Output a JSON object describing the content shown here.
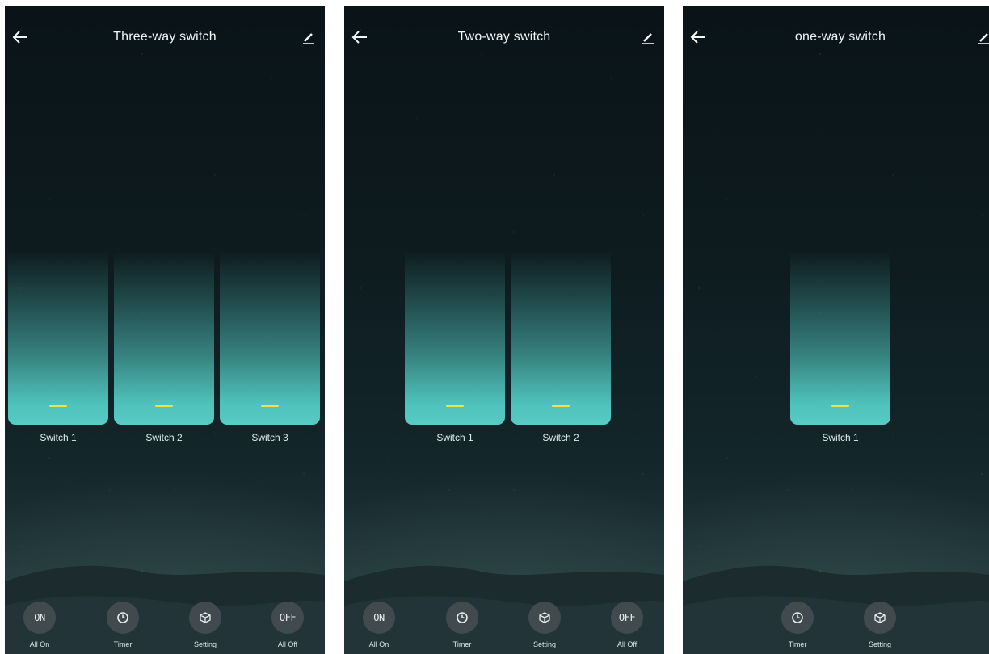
{
  "screens": [
    {
      "title": "Three-way switch",
      "switches": [
        "Switch 1",
        "Switch 2",
        "Switch 3"
      ],
      "actions": [
        {
          "label": "All On",
          "glyph": "ON",
          "icon": "power-on-icon"
        },
        {
          "label": "Timer",
          "icon": "clock-icon"
        },
        {
          "label": "Setting",
          "icon": "settings-cube-icon"
        },
        {
          "label": "All Off",
          "glyph": "OFF",
          "icon": "power-off-icon"
        }
      ]
    },
    {
      "title": "Two-way switch",
      "switches": [
        "Switch 1",
        "Switch 2"
      ],
      "actions": [
        {
          "label": "All On",
          "glyph": "ON",
          "icon": "power-on-icon"
        },
        {
          "label": "Timer",
          "icon": "clock-icon"
        },
        {
          "label": "Setting",
          "icon": "settings-cube-icon"
        },
        {
          "label": "All Off",
          "glyph": "OFF",
          "icon": "power-off-icon"
        }
      ]
    },
    {
      "title": "one-way switch",
      "switches": [
        "Switch 1"
      ],
      "actions": [
        {
          "label": "Timer",
          "icon": "clock-icon"
        },
        {
          "label": "Setting",
          "icon": "settings-cube-icon"
        }
      ]
    }
  ],
  "colors": {
    "switch_fill": "#4fc2bb",
    "indicator": "#f0e24a",
    "background": "#0d1a1e",
    "button_circle": "#464f51"
  }
}
